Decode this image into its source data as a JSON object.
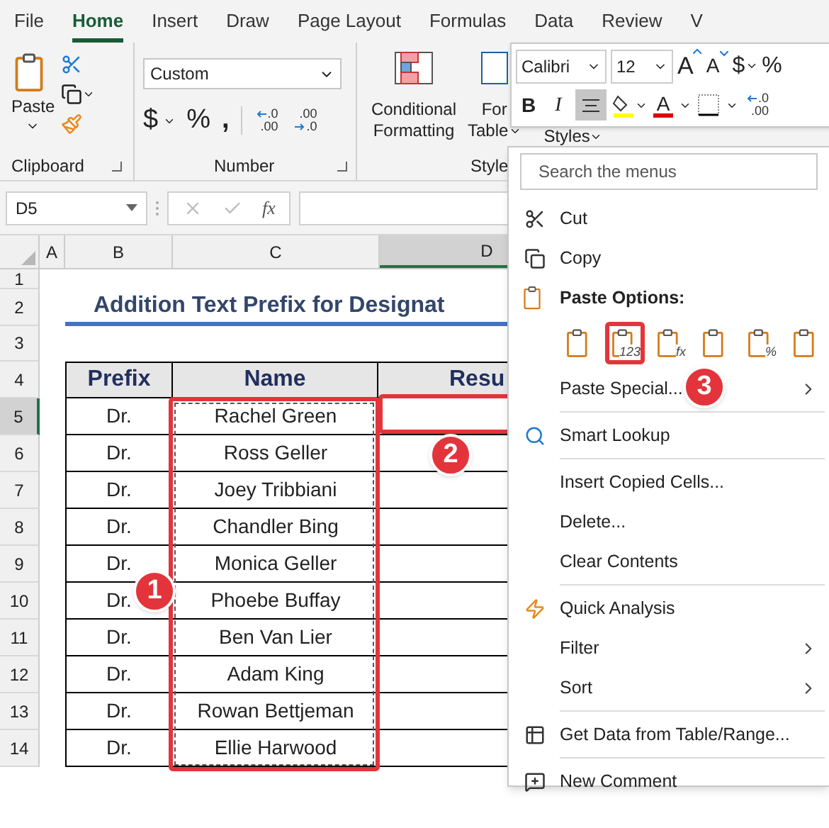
{
  "tabs": [
    {
      "label": "File",
      "selected": false
    },
    {
      "label": "Home",
      "selected": true
    },
    {
      "label": "Insert",
      "selected": false
    },
    {
      "label": "Draw",
      "selected": false
    },
    {
      "label": "Page Layout",
      "selected": false
    },
    {
      "label": "Formulas",
      "selected": false
    },
    {
      "label": "Data",
      "selected": false
    },
    {
      "label": "Review",
      "selected": false
    },
    {
      "label": "V",
      "selected": false
    }
  ],
  "ribbon": {
    "clipboard": {
      "paste": "Paste",
      "label": "Clipboard"
    },
    "number": {
      "format": "Custom",
      "currency": "$",
      "percent": "%",
      "comma": ",",
      "increase_decimal": [
        ".0",
        ".00"
      ],
      "decrease_decimal": [
        ".00",
        ".0"
      ],
      "label": "Number"
    },
    "styles": {
      "conditional": "Conditional Formatting",
      "format_table": [
        "For",
        "Table"
      ],
      "cell_styles": "Styles",
      "label": "Style"
    }
  },
  "formula_bar": {
    "name_box": "D5",
    "fx": "fx"
  },
  "columns": [
    {
      "label": "A",
      "selected": false
    },
    {
      "label": "B",
      "selected": false
    },
    {
      "label": "C",
      "selected": false
    },
    {
      "label": "D",
      "selected": true
    }
  ],
  "rows": [
    {
      "label": "1",
      "selected": false
    },
    {
      "label": "2",
      "selected": false
    },
    {
      "label": "3",
      "selected": false
    },
    {
      "label": "4",
      "selected": false
    },
    {
      "label": "5",
      "selected": true
    },
    {
      "label": "6",
      "selected": false
    },
    {
      "label": "7",
      "selected": false
    },
    {
      "label": "8",
      "selected": false
    },
    {
      "label": "9",
      "selected": false
    },
    {
      "label": "10",
      "selected": false
    },
    {
      "label": "11",
      "selected": false
    },
    {
      "label": "12",
      "selected": false
    },
    {
      "label": "13",
      "selected": false
    },
    {
      "label": "14",
      "selected": false
    }
  ],
  "title": "Addition Text Prefix for Designat",
  "table": {
    "columns": [
      "Prefix",
      "Name",
      "Resu"
    ],
    "rows": [
      {
        "prefix": "Dr.",
        "name": "Rachel Green"
      },
      {
        "prefix": "Dr.",
        "name": "Ross Geller"
      },
      {
        "prefix": "Dr.",
        "name": "Joey Tribbiani"
      },
      {
        "prefix": "Dr.",
        "name": "Chandler Bing"
      },
      {
        "prefix": "Dr.",
        "name": "Monica Geller"
      },
      {
        "prefix": "Dr.",
        "name": "Phoebe Buffay"
      },
      {
        "prefix": "Dr.",
        "name": "Ben Van Lier"
      },
      {
        "prefix": "Dr.",
        "name": "Adam King"
      },
      {
        "prefix": "Dr.",
        "name": "Rowan Bettjeman"
      },
      {
        "prefix": "Dr.",
        "name": "Ellie Harwood"
      }
    ]
  },
  "mini_toolbar": {
    "font": "Calibri",
    "size": "12",
    "grow": "A",
    "shrink": "A",
    "currency": "$",
    "percent": "%",
    "bold": "B",
    "italic": "I",
    "align_selected": true,
    "font_color": "A",
    "decimal": [
      ".0",
      ".00"
    ]
  },
  "context_menu": {
    "search": {
      "placeholder": "Search the menus"
    },
    "items": [
      {
        "kind": "item",
        "label": "Cut",
        "submenu": false
      },
      {
        "kind": "item",
        "label": "Copy",
        "submenu": false
      },
      {
        "kind": "heading",
        "label": "Paste Options:"
      },
      {
        "kind": "paste_options",
        "options": [
          {
            "highlighted": false
          },
          {
            "highlighted": true,
            "badge": "123"
          },
          {
            "highlighted": false,
            "badge": "fx"
          },
          {
            "highlighted": false
          },
          {
            "highlighted": false,
            "badge": "%"
          },
          {
            "highlighted": false
          }
        ]
      },
      {
        "kind": "item",
        "label": "Paste Special...",
        "submenu": true
      },
      {
        "kind": "separator"
      },
      {
        "kind": "item",
        "label": "Smart Lookup",
        "submenu": false
      },
      {
        "kind": "separator"
      },
      {
        "kind": "item",
        "label": "Insert Copied Cells...",
        "submenu": false
      },
      {
        "kind": "item",
        "label": "Delete...",
        "submenu": false
      },
      {
        "kind": "item",
        "label": "Clear Contents",
        "submenu": false
      },
      {
        "kind": "separator"
      },
      {
        "kind": "item",
        "label": "Quick Analysis",
        "submenu": false
      },
      {
        "kind": "item",
        "label": "Filter",
        "submenu": true
      },
      {
        "kind": "item",
        "label": "Sort",
        "submenu": true
      },
      {
        "kind": "separator"
      },
      {
        "kind": "item",
        "label": "Get Data from Table/Range...",
        "submenu": false
      },
      {
        "kind": "separator"
      },
      {
        "kind": "item",
        "label": "New Comment",
        "submenu": false
      }
    ]
  },
  "callouts": [
    "1",
    "2",
    "3"
  ]
}
